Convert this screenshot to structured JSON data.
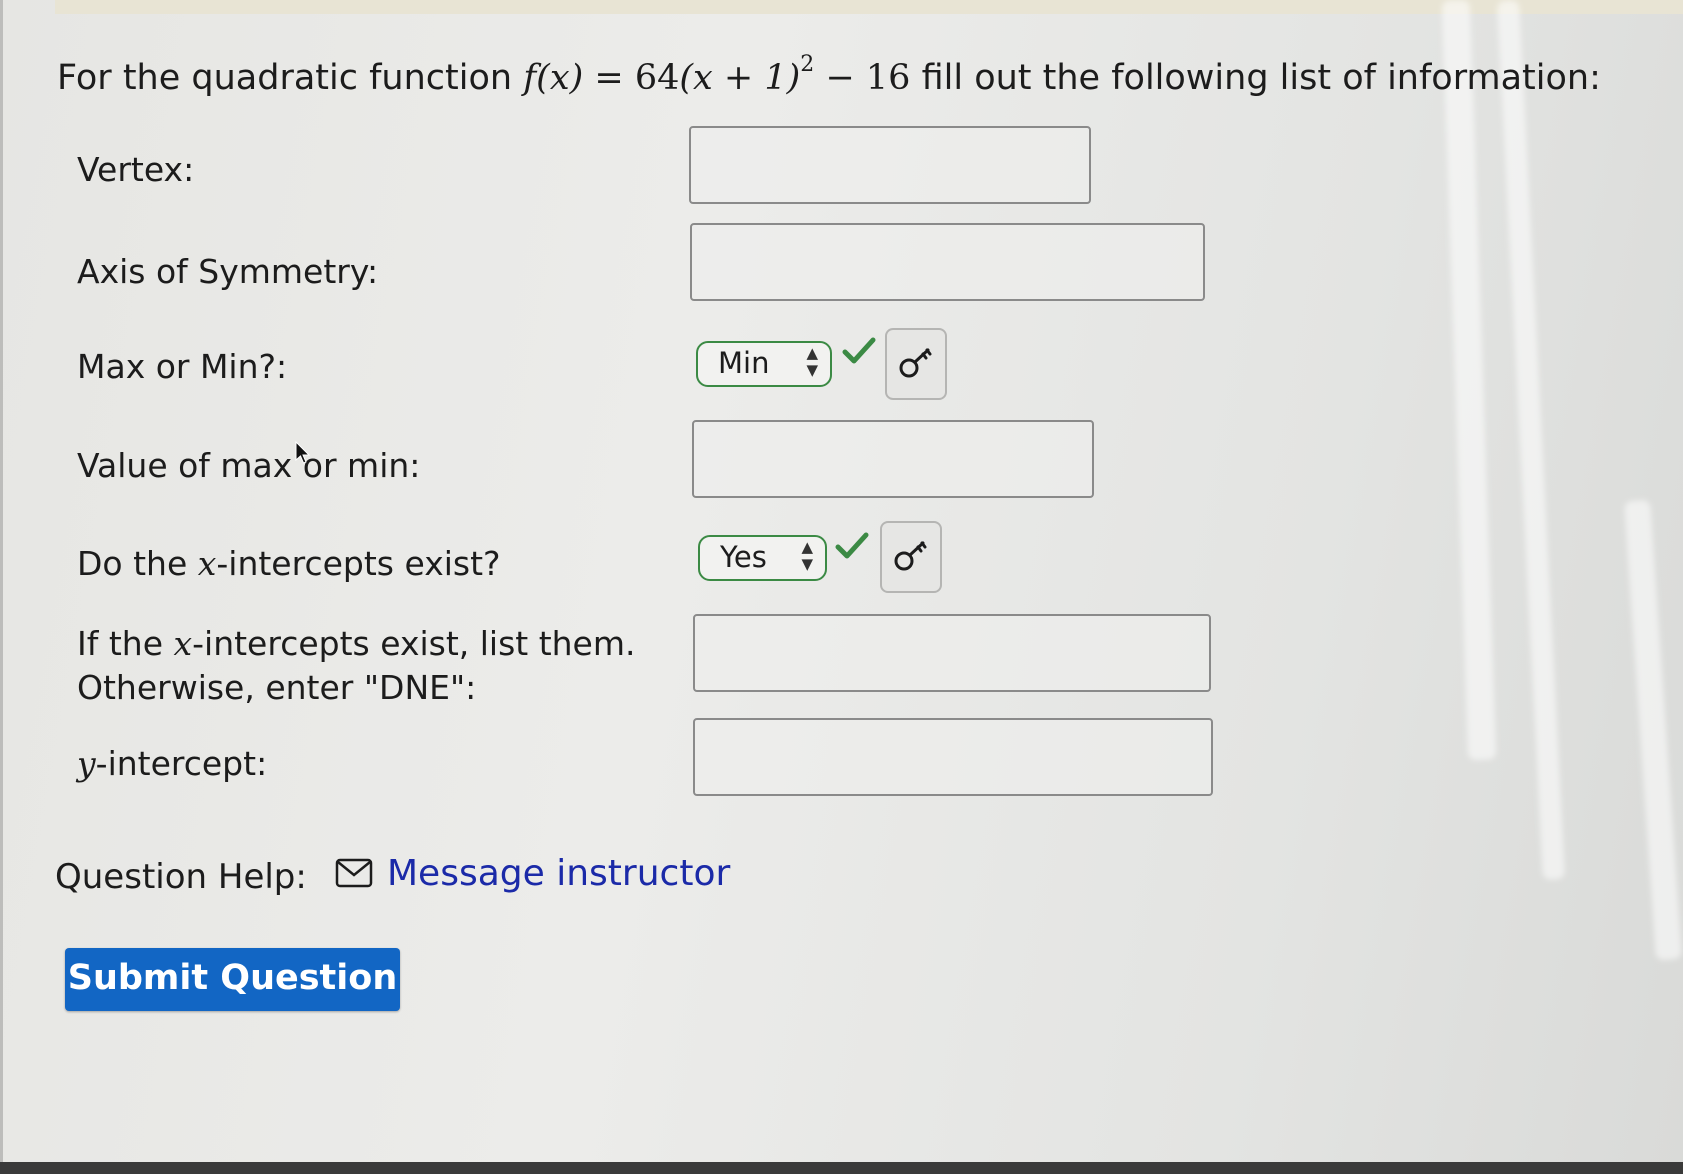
{
  "question": {
    "prefix": "For the quadratic function",
    "function": {
      "lhs": "f(x)",
      "equals": "=",
      "coefficient": "64",
      "inner": "(x + 1)",
      "exponent": "2",
      "tail": "− 16"
    },
    "suffix": "fill out the following list of information:"
  },
  "fields": {
    "vertex": {
      "label": "Vertex:",
      "value": ""
    },
    "axis_of_symmetry": {
      "label": "Axis of Symmetry:",
      "value": ""
    },
    "max_or_min": {
      "label": "Max or Min?:",
      "selected": "Min",
      "status": "correct"
    },
    "value_max_min": {
      "label": "Value of max or min:",
      "value": ""
    },
    "x_intercepts_exist": {
      "label_pre": "Do the ",
      "label_var": "x",
      "label_post": "-intercepts exist?",
      "selected": "Yes",
      "status": "correct"
    },
    "x_intercepts": {
      "line1_pre": "If the ",
      "line1_var": "x",
      "line1_post": "-intercepts exist, list them.",
      "line2": "Otherwise, enter \"DNE\":",
      "value": ""
    },
    "y_intercept": {
      "label_var": "y",
      "label_post": "-intercept:",
      "value": ""
    }
  },
  "help": {
    "label": "Question Help:",
    "link": "Message instructor"
  },
  "submit_label": "Submit Question",
  "colors": {
    "correct": "#3b8a44",
    "link": "#1b2aa8",
    "submit": "#1266c4"
  },
  "icons": {
    "check": "check-icon",
    "key": "key-icon",
    "mail": "envelope-icon"
  }
}
